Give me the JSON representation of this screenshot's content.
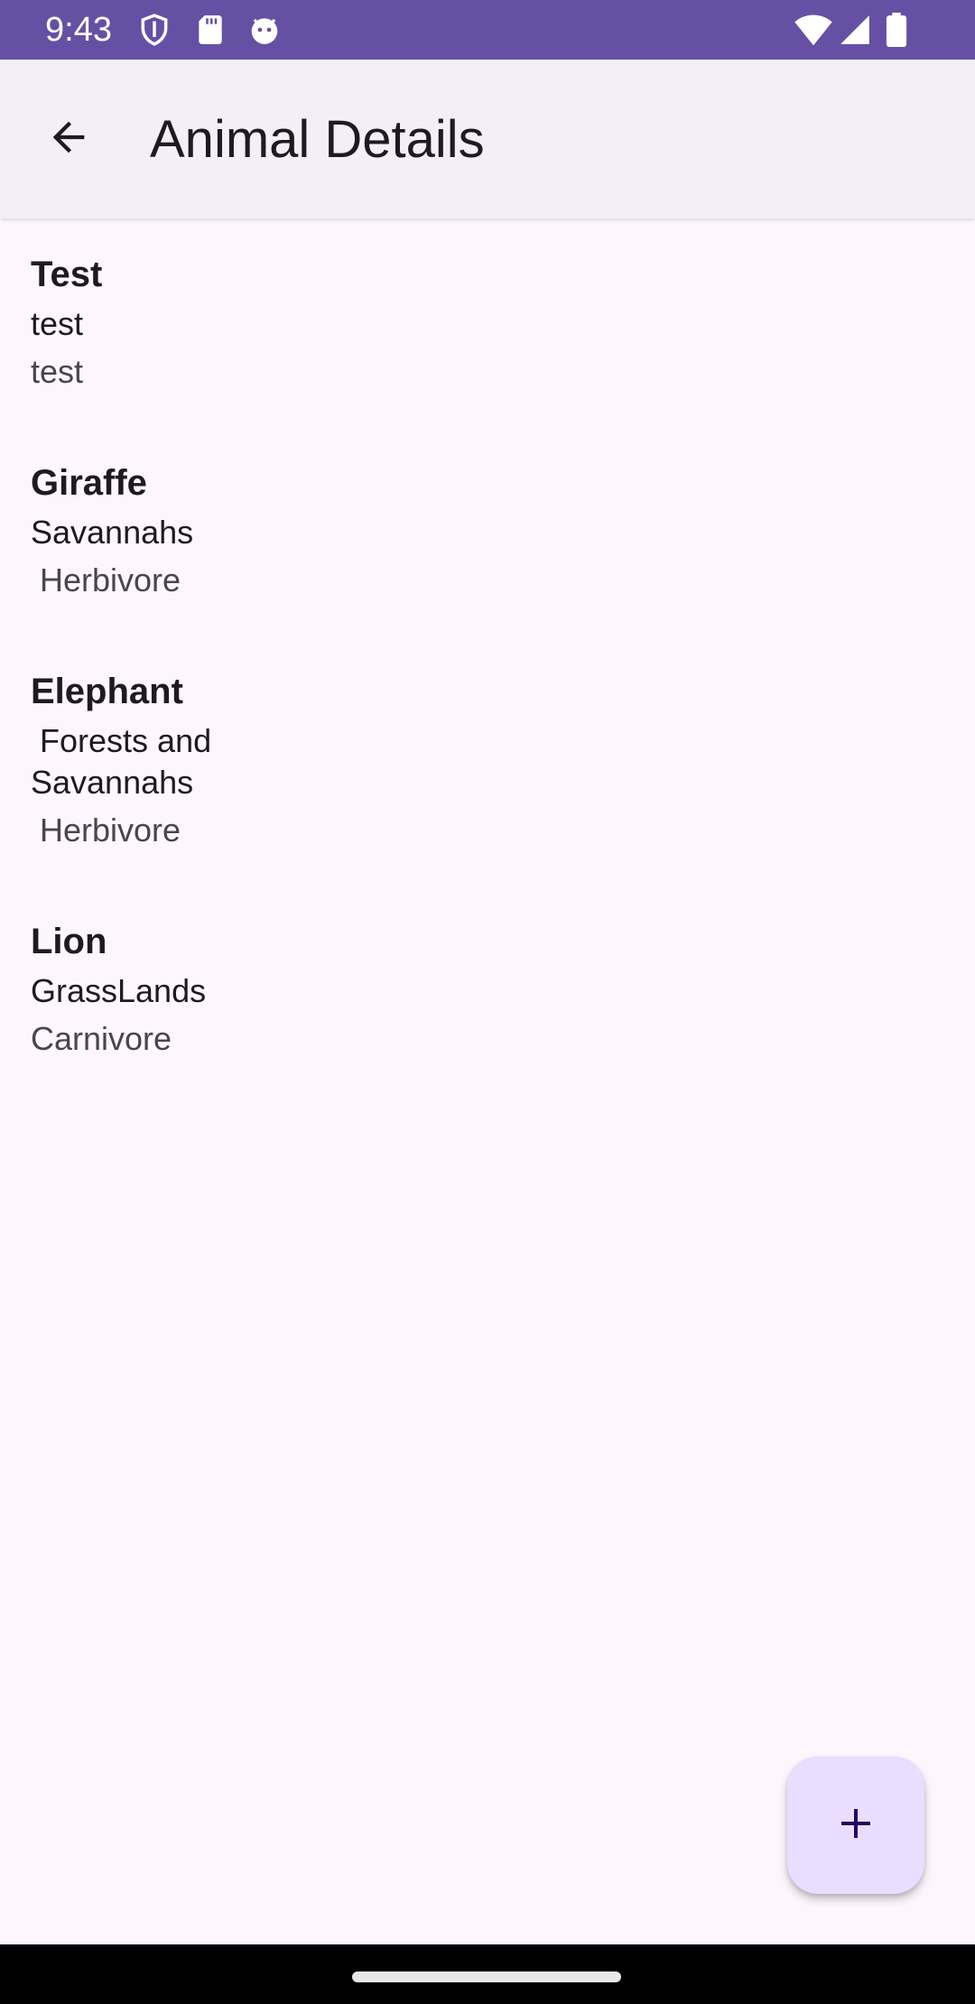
{
  "status_bar": {
    "time": "9:43",
    "icons": [
      "shield-icon",
      "sd-card-icon",
      "android-debug-icon",
      "wifi-icon",
      "signal-icon",
      "battery-icon"
    ],
    "background": "#6650a4"
  },
  "app_bar": {
    "title": "Animal Details",
    "back_icon": "arrow-back-icon",
    "background": "#f3eff7"
  },
  "animals": [
    {
      "name": "Test",
      "habitat": "test",
      "diet": "test"
    },
    {
      "name": "Giraffe",
      "habitat": "Savannahs",
      "diet": " Herbivore"
    },
    {
      "name": "Elephant",
      "habitat": " Forests and Savannahs",
      "diet": " Herbivore"
    },
    {
      "name": "Lion",
      "habitat": "GrassLands",
      "diet": "Carnivore"
    }
  ],
  "fab": {
    "icon": "plus-icon",
    "background": "#eaddff"
  },
  "colors": {
    "background": "#fdf7fd",
    "accent": "#6650a4",
    "text_primary": "#1d1b20",
    "text_secondary": "#49454f"
  }
}
